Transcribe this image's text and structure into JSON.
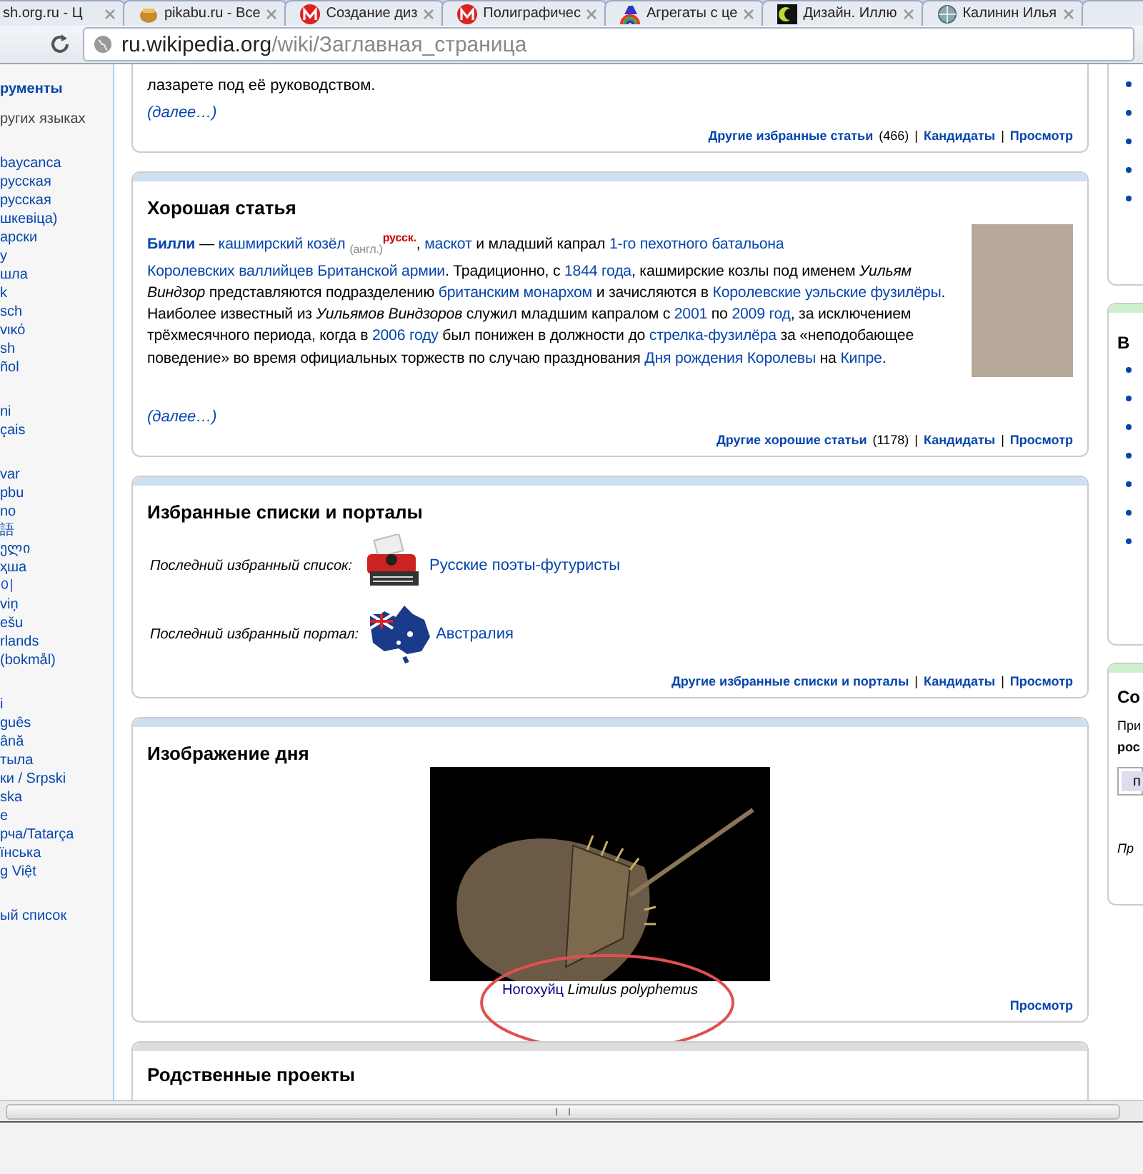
{
  "browser": {
    "tabs": [
      {
        "title": "sh.org.ru - Ц"
      },
      {
        "title": "pikabu.ru - Все"
      },
      {
        "title": "Создание диз"
      },
      {
        "title": "Полиграфичес"
      },
      {
        "title": "Агрегаты с це"
      },
      {
        "title": "Дизайн. Иллю"
      },
      {
        "title": "Калинин Илья"
      }
    ],
    "address": {
      "domain": "ru.wikipedia.org",
      "path": "/wiki/Заглавная_страница"
    }
  },
  "sidebar": {
    "tools_heading": "рументы",
    "languages_heading": "ругих языках",
    "language_groups": [
      [
        "baycanca",
        "русская",
        "русская",
        "шкевіца)",
        "арски",
        "y",
        "шла",
        "k",
        "sch",
        "vικό",
        "sh",
        "ñol"
      ],
      [
        "ni",
        "çais"
      ],
      [
        "var",
        "pbu",
        "no",
        "語",
        "ელი",
        "ҳша",
        "이",
        "viņ",
        "ešu",
        "rlands",
        "(bokmål)"
      ],
      [
        "i",
        "guês",
        "ână",
        "тыла",
        "ки / Srpski",
        "ska",
        "e",
        "рча/Tatarça",
        "їнська",
        "g Việt"
      ]
    ],
    "footer_link": "ый список"
  },
  "featured_article": {
    "last_line": "лазарете под её руководством.",
    "more": "(далее…)",
    "footer": [
      {
        "kind": "link",
        "text": "Другие избранные статьи"
      },
      {
        "kind": "count",
        "text": "(466)"
      },
      {
        "kind": "separator",
        "text": "|"
      },
      {
        "kind": "link",
        "text": "Кандидаты"
      },
      {
        "kind": "separator",
        "text": "|"
      },
      {
        "kind": "link",
        "text": "Просмотр"
      }
    ]
  },
  "good_article": {
    "title": "Хорошая статья",
    "text": [
      {
        "kind": "bold_link",
        "text": "Билли"
      },
      {
        "kind": "text",
        "text": " — "
      },
      {
        "kind": "link",
        "text": "кашмирский козёл"
      },
      {
        "kind": "sub_note",
        "text": "(англ.)"
      },
      {
        "kind": "sup_link",
        "text": "русск."
      },
      {
        "kind": "text",
        "text": ", "
      },
      {
        "kind": "link",
        "text": "маскот"
      },
      {
        "kind": "text",
        "text": " и младший капрал "
      },
      {
        "kind": "link",
        "text": "1-го пехотного батальона"
      },
      {
        "kind": "link",
        "text": "Королевских валлийцев"
      },
      {
        "kind": "link",
        "text": "Британской армии"
      },
      {
        "kind": "text",
        "text": ". Традиционно, с "
      },
      {
        "kind": "link",
        "text": "1844 года"
      },
      {
        "kind": "text",
        "text": ", кашмирские козлы под именем *Уильям Виндзор* представляются подразделению "
      },
      {
        "kind": "link",
        "text": "британским монархом"
      },
      {
        "kind": "text",
        "text": " и зачисляются в "
      },
      {
        "kind": "link",
        "text": "Королевские уэльские фузилёры"
      },
      {
        "kind": "text",
        "text": ". Наиболее известный из *Уильямов Виндзоров* служил младшим капралом с "
      },
      {
        "kind": "link",
        "text": "2001"
      },
      {
        "kind": "text",
        "text": " по "
      },
      {
        "kind": "link",
        "text": "2009 год"
      },
      {
        "kind": "text",
        "text": ", за исключением трёхмесячного периода, когда в "
      },
      {
        "kind": "link",
        "text": "2006 году"
      },
      {
        "kind": "text",
        "text": " был понижен в должности до "
      },
      {
        "kind": "link",
        "text": "стрелка-фузилёра"
      },
      {
        "kind": "text",
        "text": " за «неподобающее поведение» во время официальных торжеств по случаю празднования "
      },
      {
        "kind": "link",
        "text": "Дня рождения Королевы"
      },
      {
        "kind": "text",
        "text": " на "
      },
      {
        "kind": "link",
        "text": "Кипре"
      },
      {
        "kind": "text",
        "text": "."
      }
    ],
    "more": "(далее…)",
    "footer": [
      {
        "kind": "link",
        "text": "Другие хорошие статьи"
      },
      {
        "kind": "count",
        "text": "(1178)"
      },
      {
        "kind": "separator",
        "text": "|"
      },
      {
        "kind": "link",
        "text": "Кандидаты"
      },
      {
        "kind": "separator",
        "text": "|"
      },
      {
        "kind": "link",
        "text": "Просмотр"
      }
    ]
  },
  "featured_lists": {
    "title": "Избранные списки и порталы",
    "rows": [
      {
        "label": "Последний избранный список:",
        "link": "Русские поэты-футуристы"
      },
      {
        "label": "Последний избранный портал:",
        "link": "Австралия"
      }
    ],
    "footer": [
      {
        "kind": "link",
        "text": "Другие избранные списки и порталы"
      },
      {
        "kind": "separator",
        "text": "|"
      },
      {
        "kind": "link",
        "text": "Кандидаты"
      },
      {
        "kind": "separator",
        "text": "|"
      },
      {
        "kind": "link",
        "text": "Просмотр"
      }
    ]
  },
  "picture_of_day": {
    "title": "Изображение дня",
    "caption_link": "Ногохуйц",
    "caption_latin": "Limulus polyphemus",
    "footer": [
      {
        "kind": "link",
        "text": "Просмотр"
      }
    ]
  },
  "related_projects": {
    "title": "Родственные проекты"
  },
  "right_column": {
    "second_heading": "В",
    "third_heading": "Со",
    "third_line": "При",
    "third_bold": "рос",
    "third_button": "п",
    "third_italic": "Пр"
  }
}
